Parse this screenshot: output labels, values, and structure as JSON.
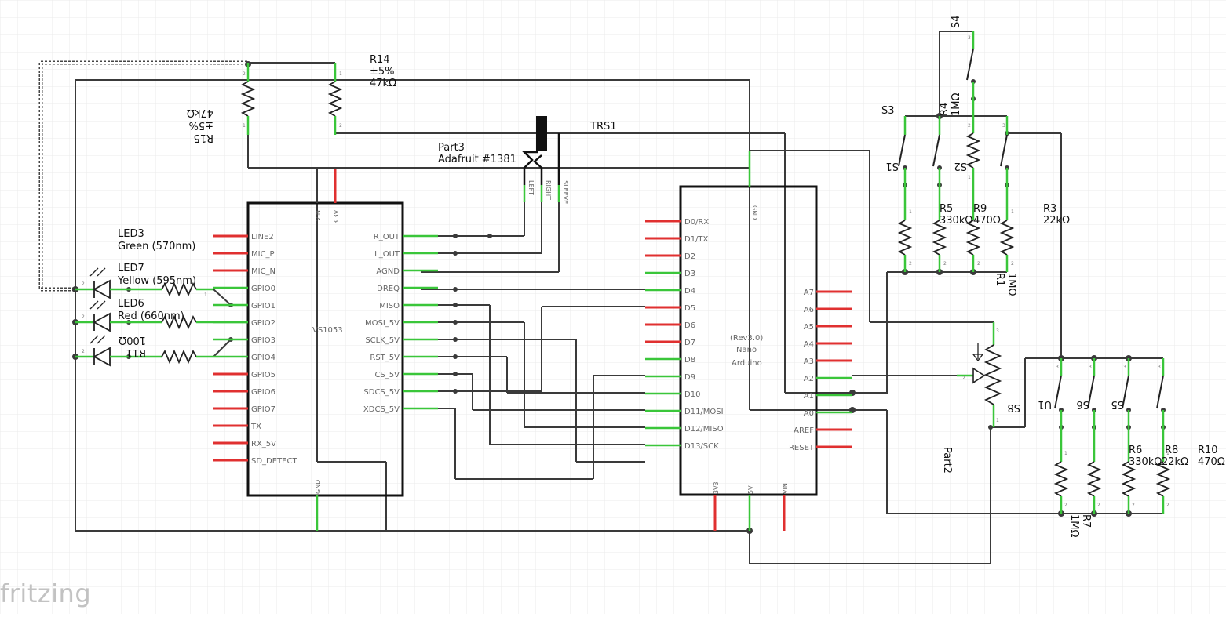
{
  "colors": {
    "wire": "#3a3a3a",
    "pin_connected": "#3ac63a",
    "pin_unconnected": "#e03030",
    "grid": "#ebebeb"
  },
  "watermark": "fritzing",
  "vs1053": {
    "name": "VS1053",
    "left_pins": [
      "LINE2",
      "MIC_P",
      "MIC_N",
      "GPIO0",
      "GPIO1",
      "GPIO2",
      "GPIO3",
      "GPIO4",
      "GPIO5",
      "GPIO6",
      "GPIO7",
      "TX",
      "RX_5V",
      "SD_DETECT"
    ],
    "right_pins": [
      "R_OUT",
      "L_OUT",
      "AGND",
      "DREQ",
      "MISO",
      "MOSI_5V",
      "SCLK_5V",
      "RST_5V",
      "CS_5V",
      "SDCS_5V",
      "XDCS_5V"
    ],
    "top_pins": [
      "VIN",
      "3.3V"
    ],
    "bottom_pin": "GND"
  },
  "arduino": {
    "line1": "(Rev3.0)",
    "line2": "Nano",
    "line3": "Arduino",
    "left_pins": [
      "D0/RX",
      "D1/TX",
      "D2",
      "D3",
      "D4",
      "D5",
      "D6",
      "D7",
      "D8",
      "D9",
      "D10",
      "D11/MOSI",
      "D12/MISO",
      "D13/SCK"
    ],
    "right_pins": [
      "A7",
      "A6",
      "A5",
      "A4",
      "A3",
      "A2",
      "A1",
      "A0",
      "AREF",
      "RESET"
    ],
    "top_pin": "GND",
    "bottom_pins": [
      "3V3",
      "5V",
      "VIN"
    ]
  },
  "trs": {
    "name": "TRS1",
    "pins": [
      "LEFT",
      "RIGHT",
      "SLEEVE"
    ]
  },
  "part3": {
    "line1": "Part3",
    "line2": "Adafruit #1381"
  },
  "r14": {
    "line1": "R14",
    "line2": "±5%",
    "line3": "47kΩ"
  },
  "r15": {
    "line1": "R15",
    "line2": "±5%",
    "line3": "47kΩ"
  },
  "leds": [
    {
      "line1": "LED3",
      "line2": "Green (570nm)"
    },
    {
      "line1": "LED7",
      "line2": "Yellow (595nm)"
    },
    {
      "line1": "LED6",
      "line2": "Red (660nm)"
    }
  ],
  "r11": {
    "line1": "R11",
    "line2": "100Ω"
  },
  "top_right": {
    "s4": "S4",
    "s3": "S3",
    "s1": "S1",
    "s2": "S2",
    "r4": {
      "line1": "R4",
      "line2": "1MΩ"
    },
    "r5": {
      "line1": "R5",
      "line2": "330kΩ"
    },
    "r9": {
      "line1": "R9",
      "line2": "470Ω"
    },
    "r3": {
      "line1": "R3",
      "line2": "22kΩ"
    },
    "r1": {
      "line1": "R1",
      "line2": "1MΩ"
    }
  },
  "bottom_right": {
    "u1": "U1",
    "s6": "S6",
    "s5": "S5",
    "s8": "S8",
    "part2": "Part2",
    "r6": {
      "line1": "R6",
      "line2": "330kΩ"
    },
    "r8": {
      "line1": "R8",
      "line2": "22kΩ"
    },
    "r10": {
      "line1": "R10",
      "line2": "470Ω"
    },
    "r7": {
      "line1": "R7",
      "line2": "1MΩ"
    }
  },
  "pin_numbers": {
    "one": "1",
    "two": "2",
    "three": "3"
  }
}
